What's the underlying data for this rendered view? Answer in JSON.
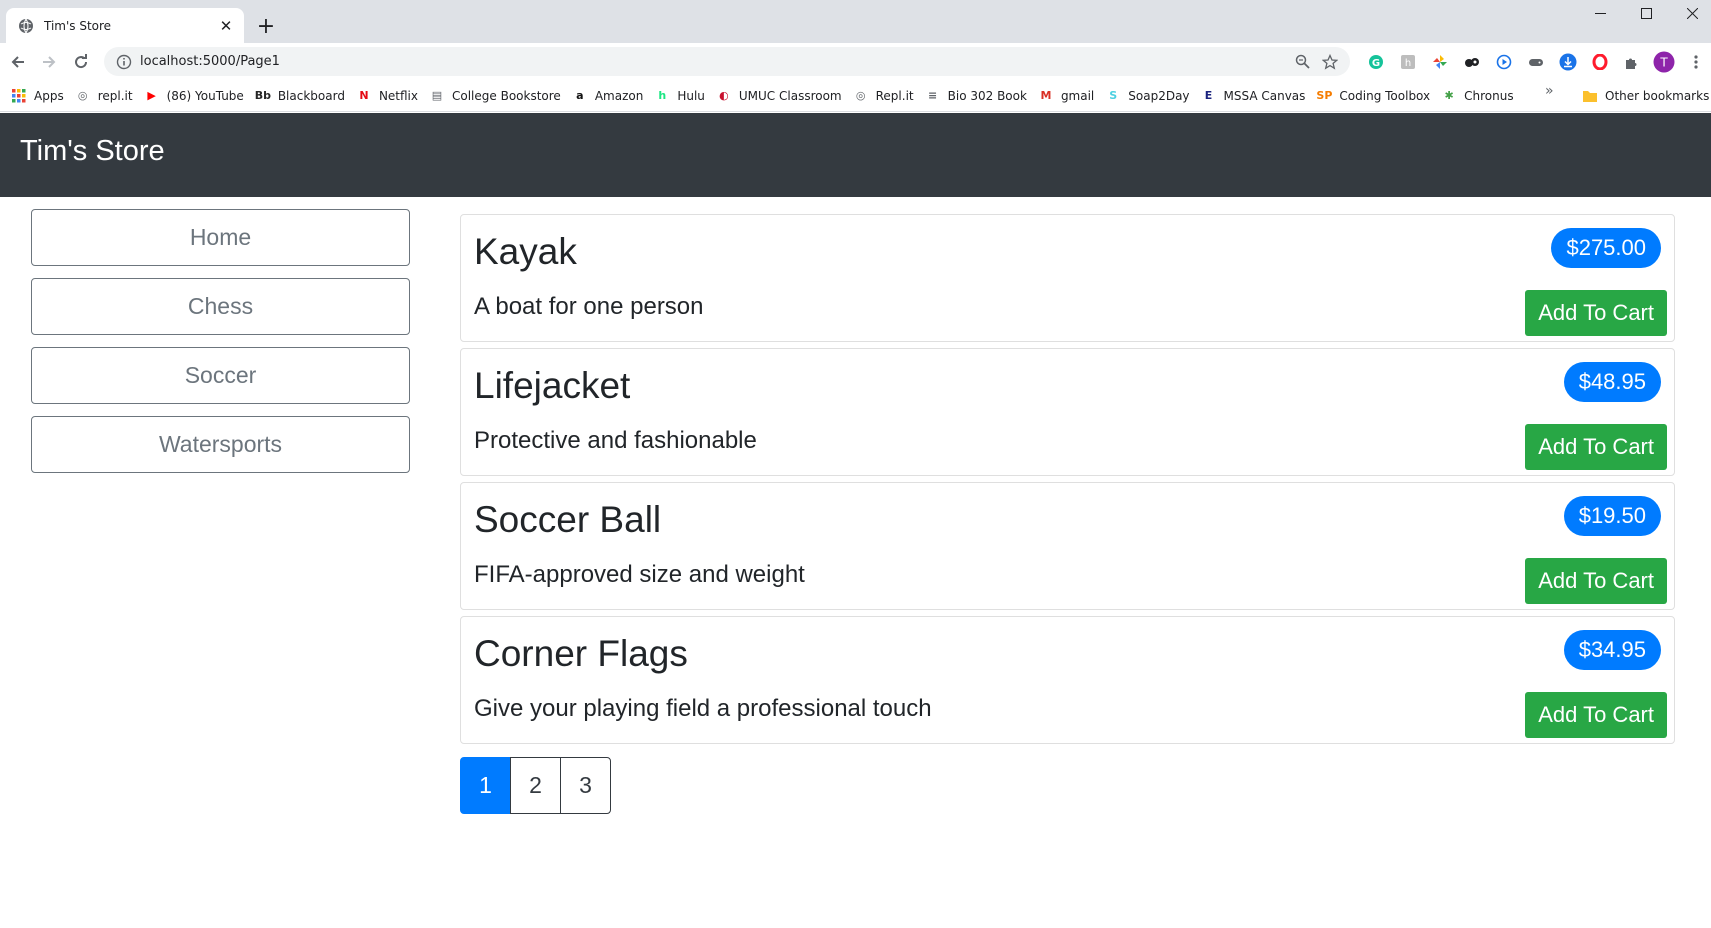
{
  "browser": {
    "tab_title": "Tim's Store",
    "url": "localhost:5000/Page1",
    "bookmarks": [
      {
        "label": "Apps",
        "icon": "apps-grid-icon",
        "color": "#e8453c"
      },
      {
        "label": "repl.it",
        "icon": "replit-icon",
        "color": "#5f6368"
      },
      {
        "label": "(86) YouTube",
        "icon": "youtube-icon",
        "color": "#ff0000"
      },
      {
        "label": "Blackboard",
        "icon": "blackboard-icon",
        "color": "#262626"
      },
      {
        "label": "Netflix",
        "icon": "netflix-icon",
        "color": "#e50914"
      },
      {
        "label": "College Bookstore",
        "icon": "page-icon",
        "color": "#5f6368"
      },
      {
        "label": "Amazon",
        "icon": "amazon-icon",
        "color": "#111111"
      },
      {
        "label": "Hulu",
        "icon": "hulu-icon",
        "color": "#1ce783"
      },
      {
        "label": "UMUC Classroom",
        "icon": "umuc-icon",
        "color": "#c8102e"
      },
      {
        "label": "Repl.it",
        "icon": "replit-icon",
        "color": "#5f6368"
      },
      {
        "label": "Bio 302 Book",
        "icon": "book-icon",
        "color": "#5f6368"
      },
      {
        "label": "gmail",
        "icon": "gmail-icon",
        "color": "#d93025"
      },
      {
        "label": "Soap2Day",
        "icon": "soap2day-icon",
        "color": "#4dd0e1"
      },
      {
        "label": "MSSA Canvas",
        "icon": "canvas-icon",
        "color": "#1a237e"
      },
      {
        "label": "Coding Toolbox",
        "icon": "toolbox-icon",
        "color": "#f57c00"
      },
      {
        "label": "Chronus",
        "icon": "chronus-icon",
        "color": "#43a047"
      }
    ],
    "other_bookmarks": "Other bookmarks",
    "profile_initial": "T"
  },
  "store": {
    "brand": "Tim's Store",
    "categories": [
      "Home",
      "Chess",
      "Soccer",
      "Watersports"
    ],
    "products": [
      {
        "name": "Kayak",
        "description": "A boat for one person",
        "price": "$275.00"
      },
      {
        "name": "Lifejacket",
        "description": "Protective and fashionable",
        "price": "$48.95"
      },
      {
        "name": "Soccer Ball",
        "description": "FIFA-approved size and weight",
        "price": "$19.50"
      },
      {
        "name": "Corner Flags",
        "description": "Give your playing field a professional touch",
        "price": "$34.95"
      }
    ],
    "add_to_cart_label": "Add To Cart",
    "pages": [
      "1",
      "2",
      "3"
    ],
    "current_page": "1"
  },
  "colors": {
    "navbar_bg": "#343a40",
    "price_badge": "#007bff",
    "add_button": "#28a745",
    "outline": "#6c757d"
  }
}
